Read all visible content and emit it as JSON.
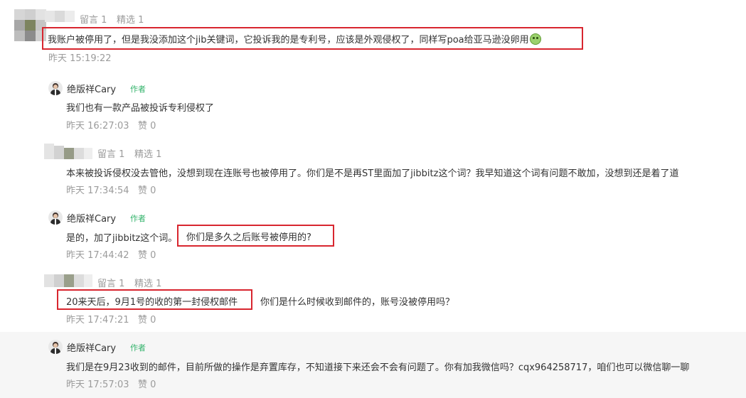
{
  "comments": [
    {
      "stats": {
        "replies": "留言 1",
        "featured": "精选 1"
      },
      "text": "我账户被停用了，但是我没添加这个jib关键词，它投诉我的是专利号，应该是外观侵权了，同样写poa给亚马逊没卵用",
      "emoji": "frog-emoji",
      "time": "昨天 15:19:22",
      "reply": {
        "author": "绝版祥Cary",
        "tag": "作者",
        "text": "我们也有一款产品被投诉专利侵权了",
        "time": "昨天 16:27:03",
        "like": "赞 0"
      }
    },
    {
      "stats": {
        "replies": "留言 1",
        "featured": "精选 1"
      },
      "text": "本来被投诉侵权没去管他，没想到现在连账号也被停用了。你们是不是再ST里面加了jibbitz这个词？我早知道这个词有问题不敢加，没想到还是着了道",
      "time": "昨天 17:34:54",
      "like": "赞 0",
      "reply": {
        "author": "绝版祥Cary",
        "tag": "作者",
        "text_part1": "是的，加了jibbitz这个词。",
        "text_part2": "你们是多久之后账号被停用的?",
        "time": "昨天 17:44:42",
        "like": "赞 0"
      }
    },
    {
      "stats": {
        "replies": "留言 1",
        "featured": "精选 1"
      },
      "text_part1": "20来天后，9月1号的收的第一封侵权邮件",
      "text_part2": "你们是什么时候收到邮件的，账号没被停用吗？",
      "time": "昨天 17:47:21",
      "like": "赞 0",
      "reply": {
        "author": "绝版祥Cary",
        "tag": "作者",
        "text": "我们是在9月23收到的邮件，目前所做的操作是弃置库存，不知道接下来还会不会有问题了。你有加我微信吗？cqx964258717，咱们也可以微信聊一聊",
        "time": "昨天 17:57:03",
        "like": "赞 0"
      }
    }
  ],
  "colors": {
    "highlight_border": "#d8262f",
    "author_tag": "#33b36b",
    "meta": "#9b9b9b"
  }
}
